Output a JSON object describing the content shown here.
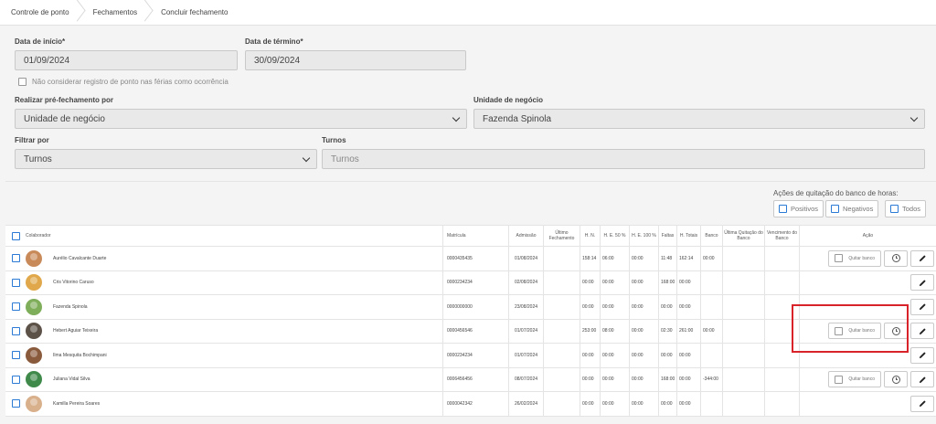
{
  "breadcrumb": [
    "Controle de ponto",
    "Fechamentos",
    "Concluir fechamento"
  ],
  "form": {
    "data_inicio_label": "Data de início*",
    "data_inicio_value": "01/09/2024",
    "data_termino_label": "Data de término*",
    "data_termino_value": "30/09/2024",
    "ferias_checkbox_label": "Não considerar registro de ponto nas férias como ocorrência",
    "pre_fechamento_label": "Realizar pré-fechamento por",
    "pre_fechamento_value": "Unidade de negócio",
    "unidade_label": "Unidade de negócio",
    "unidade_value": "Fazenda Spinola",
    "filtrar_label": "Filtrar por",
    "filtrar_value": "Turnos",
    "turnos_label": "Turnos",
    "turnos_placeholder": "Turnos"
  },
  "acoes": {
    "title": "Ações de quitação do banco de horas:",
    "positivos": "Positivos",
    "negativos": "Negativos",
    "todos": "Todos"
  },
  "table": {
    "headers": {
      "colaborador": "Colaborador",
      "matricula": "Matrícula",
      "admissao": "Admissão",
      "ultimo_fechamento": "Último Fechamento",
      "hn": "H. N.",
      "he50": "H. E. 50 %",
      "he100": "H. E. 100 %",
      "faltas": "Faltas",
      "htotais": "H. Totais",
      "banco": "Banco",
      "ultima_quitacao": "Última Quitação do Banco",
      "vencimento": "Vencimento do Banco",
      "acao": "Ação"
    },
    "quitar_label": "Quitar banco",
    "rows": [
      {
        "name": "Aurélio Cavalcante Duarte",
        "matricula": "0000435435",
        "admissao": "01/08/2024",
        "ultimo": "",
        "hn": "158:14",
        "he50": "06:00",
        "he100": "00:00",
        "faltas": "11:48",
        "htotais": "162:14",
        "banco": "00:00",
        "quitar": true,
        "avatar_color": "#c98a5a"
      },
      {
        "name": "Cris Vitorino Caruso",
        "matricula": "0000234234",
        "admissao": "02/08/2024",
        "ultimo": "",
        "hn": "00:00",
        "he50": "00:00",
        "he100": "00:00",
        "faltas": "168:00",
        "htotais": "00:00",
        "banco": "",
        "quitar": false,
        "avatar_color": "#e0a84a"
      },
      {
        "name": "Fazenda Spinola",
        "matricula": "0000000000",
        "admissao": "23/08/2024",
        "ultimo": "",
        "hn": "00:00",
        "he50": "00:00",
        "he100": "00:00",
        "faltas": "00:00",
        "htotais": "00:00",
        "banco": "",
        "quitar": false,
        "avatar_color": "#7fae5a"
      },
      {
        "name": "Hebert Aguiar Teixeira",
        "matricula": "0000456546",
        "admissao": "01/07/2024",
        "ultimo": "",
        "hn": "253:00",
        "he50": "08:00",
        "he100": "00:00",
        "faltas": "02:30",
        "htotais": "261:00",
        "banco": "00:00",
        "quitar": true,
        "avatar_color": "#5d5248"
      },
      {
        "name": "Ilma Mesquita Bochimpani",
        "matricula": "0000234234",
        "admissao": "01/07/2024",
        "ultimo": "",
        "hn": "00:00",
        "he50": "00:00",
        "he100": "00:00",
        "faltas": "00:00",
        "htotais": "00:00",
        "banco": "",
        "quitar": false,
        "avatar_color": "#8a5a3c"
      },
      {
        "name": "Juliana Vidal Silva",
        "matricula": "0006456456",
        "admissao": "08/07/2024",
        "ultimo": "",
        "hn": "00:00",
        "he50": "00:00",
        "he100": "00:00",
        "faltas": "168:00",
        "htotais": "00:00",
        "banco": "-344:00",
        "quitar": true,
        "avatar_color": "#3f8a4a"
      },
      {
        "name": "Kamilla Pereira Soares",
        "matricula": "0000042342",
        "admissao": "26/02/2024",
        "ultimo": "",
        "hn": "00:00",
        "he50": "00:00",
        "he100": "00:00",
        "faltas": "00:00",
        "htotais": "00:00",
        "banco": "",
        "quitar": false,
        "avatar_color": "#d9b08c"
      }
    ]
  }
}
